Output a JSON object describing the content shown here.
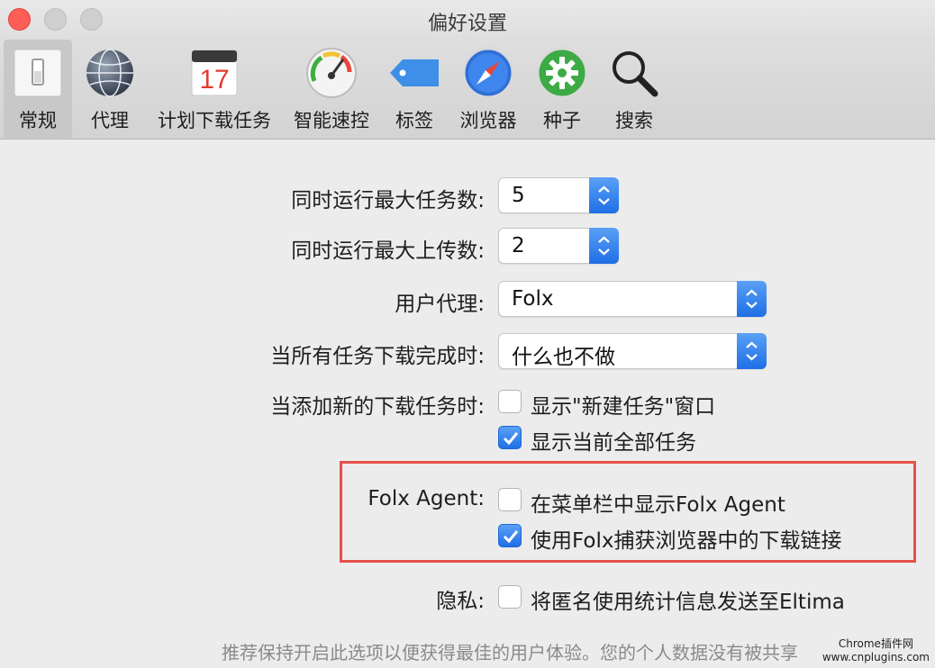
{
  "window": {
    "title": "偏好设置"
  },
  "toolbar": {
    "items": [
      {
        "label": "常规",
        "icon": "switch-icon",
        "active": true
      },
      {
        "label": "代理",
        "icon": "globe-icon"
      },
      {
        "label": "计划下载任务",
        "icon": "calendar-icon",
        "icon_text": "17"
      },
      {
        "label": "智能速控",
        "icon": "speedometer-icon"
      },
      {
        "label": "标签",
        "icon": "tag-icon"
      },
      {
        "label": "浏览器",
        "icon": "compass-icon"
      },
      {
        "label": "种子",
        "icon": "gear-icon"
      },
      {
        "label": "搜索",
        "icon": "magnifier-icon"
      }
    ]
  },
  "settings": {
    "max_tasks": {
      "label": "同时运行最大任务数:",
      "value": "5"
    },
    "max_uploads": {
      "label": "同时运行最大上传数:",
      "value": "2"
    },
    "user_agent": {
      "label": "用户代理:",
      "value": "Folx"
    },
    "on_complete": {
      "label": "当所有任务下载完成时:",
      "value": "什么也不做"
    },
    "on_add": {
      "label": "当添加新的下载任务时:",
      "options": [
        {
          "label": "显示\"新建任务\"窗口",
          "checked": false
        },
        {
          "label": "显示当前全部任务",
          "checked": true
        }
      ]
    },
    "folx_agent": {
      "label": "Folx Agent:",
      "options": [
        {
          "label": "在菜单栏中显示Folx Agent",
          "checked": false
        },
        {
          "label": "使用Folx捕获浏览器中的下载链接",
          "checked": true
        }
      ]
    },
    "privacy": {
      "label": "隐私:",
      "option": {
        "label": "将匿名使用统计信息发送至Eltima",
        "checked": false
      },
      "note": "推荐保持开启此选项以便获得最佳的用户体验。您的个人数据没有被共享"
    }
  },
  "watermark": {
    "line1": "Chrome插件网",
    "line2": "www.cnplugins.com"
  },
  "colors": {
    "accent": "#2a7cf0",
    "highlight_border": "#e5514b"
  }
}
